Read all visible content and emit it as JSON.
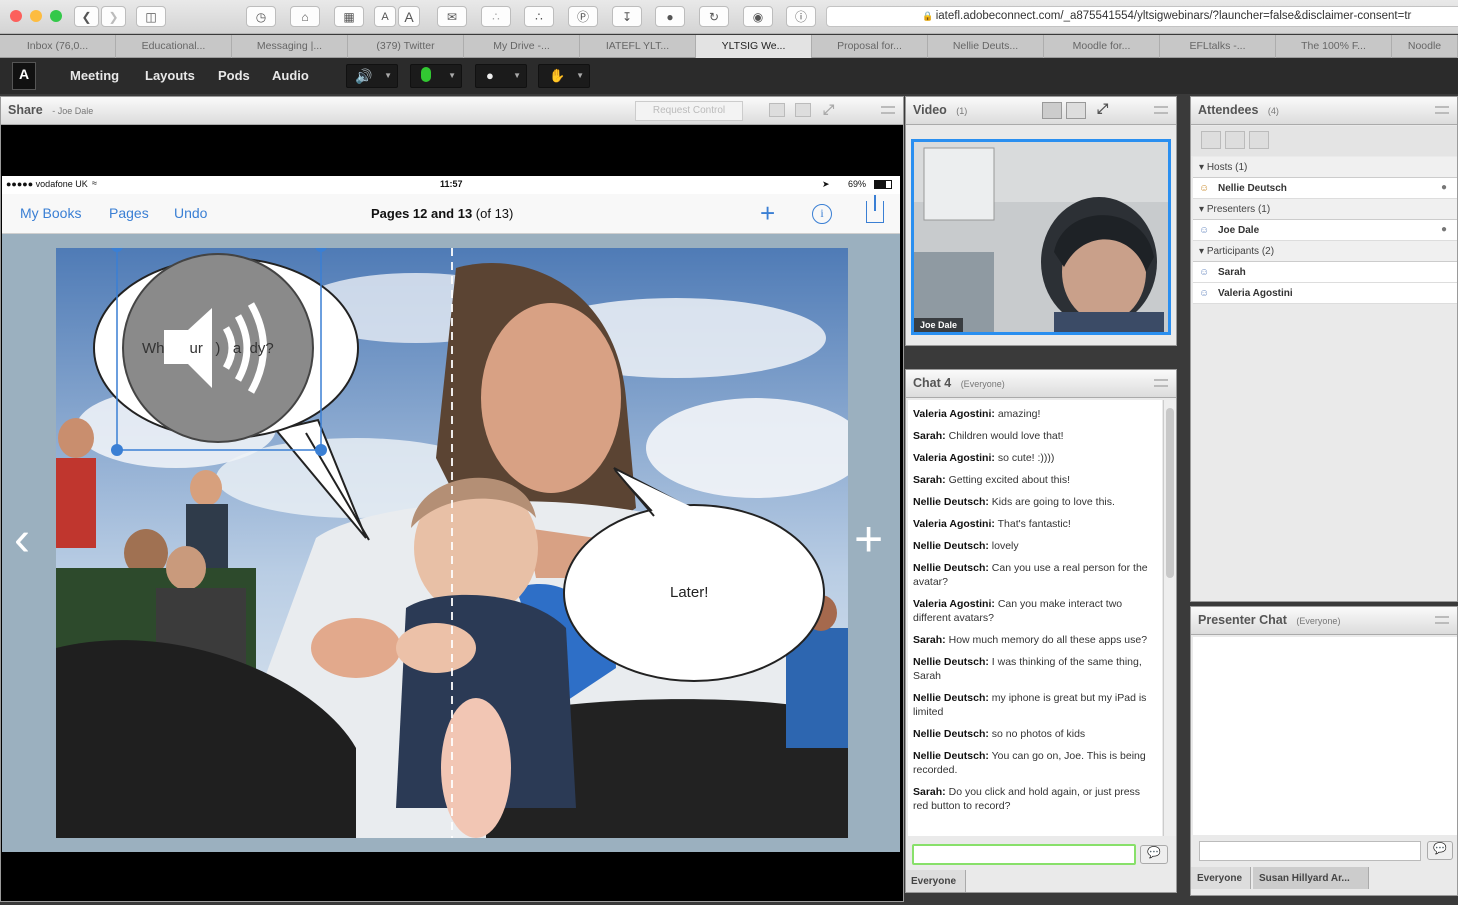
{
  "browser": {
    "url": "iatefl.adobeconnect.com/_a875541554/yltsigwebinars/?launcher=false&disclaimer-consent=tr",
    "tabs": [
      "Inbox (76,0...",
      "Educational...",
      "Messaging |...",
      "(379) Twitter",
      "My Drive -...",
      "IATEFL YLT...",
      "YLTSIG We...",
      "Proposal for...",
      "Nellie Deuts...",
      "Moodle for...",
      "EFLtalks -...",
      "The 100% F...",
      "Noodle"
    ],
    "active_tab": 6,
    "toolbar_icons": [
      "back-icon",
      "forward-icon",
      "sidebar-icon",
      "history-icon",
      "home-icon",
      "grid-icon",
      "text-smaller-icon",
      "text-larger-icon",
      "mail-icon",
      "feed-icon",
      "rss-icon",
      "pinterest-icon",
      "download-icon",
      "record-icon",
      "refresh-icon",
      "extension-icon",
      "info-icon"
    ],
    "text_smaller": "A",
    "text_larger": "A"
  },
  "connect": {
    "menu": [
      "Meeting",
      "Layouts",
      "Pods",
      "Audio"
    ],
    "accent_green": "#32c832"
  },
  "share_pod": {
    "title": "Share",
    "presenter": "- Joe Dale",
    "request_control": "Request Control"
  },
  "ipad": {
    "carrier": "●●●●● vodafone UK",
    "time": "11:57",
    "battery": "69%",
    "nav": {
      "my_books": "My Books",
      "pages": "Pages",
      "undo": "Undo"
    },
    "title_bold": "Pages 12 and 13",
    "title_rest": "(of 13)",
    "bubble_left_text": "Wh      ur   )   a  dy?",
    "bubble_right_text": "Later!"
  },
  "video_pod": {
    "title": "Video",
    "count": "(1)",
    "camera_name": "Joe Dale"
  },
  "chat_pod": {
    "title": "Chat 4",
    "scope": "(Everyone)",
    "messages": [
      {
        "name": "Valeria Agostini:",
        "text": "amazing!"
      },
      {
        "name": "Sarah:",
        "text": "Children would love that!"
      },
      {
        "name": "Valeria Agostini:",
        "text": "so cute! :))))"
      },
      {
        "name": "Sarah:",
        "text": "Getting excited about this!"
      },
      {
        "name": "Nellie Deutsch:",
        "text": "Kids are going to love this."
      },
      {
        "name": "Valeria Agostini:",
        "text": "That's fantastic!"
      },
      {
        "name": "Nellie Deutsch:",
        "text": "lovely"
      },
      {
        "name": "Nellie Deutsch:",
        "text": "Can you use a real person for the avatar?"
      },
      {
        "name": "Valeria Agostini:",
        "text": "Can you make interact two different avatars?"
      },
      {
        "name": "Sarah:",
        "text": "How much memory do all these apps use?"
      },
      {
        "name": "Nellie Deutsch:",
        "text": "I was thinking of the same thing, Sarah"
      },
      {
        "name": "Nellie Deutsch:",
        "text": "my iphone is great but my iPad is limited"
      },
      {
        "name": "Nellie Deutsch:",
        "text": "so no photos of kids"
      },
      {
        "name": "Nellie Deutsch:",
        "text": "You can go on, Joe. This is being recorded."
      },
      {
        "name": "Sarah:",
        "text": "Do you click and hold again, or just press red button to record?"
      }
    ],
    "tab": "Everyone",
    "input_value": ""
  },
  "attendees_pod": {
    "title": "Attendees",
    "count": "(4)",
    "groups": [
      {
        "label": "Hosts (1)",
        "people": [
          "Nellie Deutsch"
        ]
      },
      {
        "label": "Presenters (1)",
        "people": [
          "Joe Dale"
        ]
      },
      {
        "label": "Participants (2)",
        "people": [
          "Sarah",
          "Valeria Agostini"
        ]
      }
    ]
  },
  "presenter_chat": {
    "title": "Presenter Chat",
    "scope": "(Everyone)",
    "tabs": [
      "Everyone",
      "Susan Hillyard Ar..."
    ],
    "input_value": ""
  }
}
